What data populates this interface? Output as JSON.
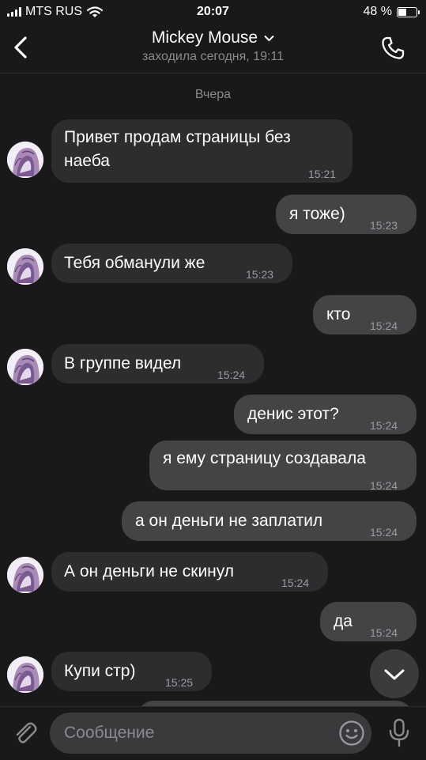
{
  "status_bar": {
    "carrier": "MTS RUS",
    "time": "20:07",
    "battery_percent": "48 %",
    "battery_level": 0.48
  },
  "header": {
    "title": "Mickey Mouse",
    "subtitle": "заходила сегодня, 19:11"
  },
  "chat": {
    "date_separator": "Вчера",
    "messages": [
      {
        "from": "in",
        "text": "Привет продам страницы без наеба",
        "time": "15:21"
      },
      {
        "from": "out",
        "text": "я тоже)",
        "time": "15:23"
      },
      {
        "from": "in",
        "text": "Тебя обманули же",
        "time": "15:23"
      },
      {
        "from": "out",
        "text": "кто",
        "time": "15:24"
      },
      {
        "from": "in",
        "text": "В группе видел",
        "time": "15:24"
      },
      {
        "from": "out",
        "text": "денис этот?",
        "time": "15:24"
      },
      {
        "from": "out",
        "text": "я ему страницу создавала",
        "time": "15:24"
      },
      {
        "from": "out",
        "text": "а он деньги не заплатил",
        "time": "15:24"
      },
      {
        "from": "in",
        "text": "А он деньги не скинул",
        "time": "15:24"
      },
      {
        "from": "out",
        "text": "да",
        "time": "15:24"
      },
      {
        "from": "in",
        "text": "Купи стр)",
        "time": "15:25"
      }
    ]
  },
  "input": {
    "placeholder": "Сообщение"
  },
  "icons": {
    "back": "chevron-left-icon",
    "call": "phone-icon",
    "attach": "paperclip-icon",
    "emoji": "smile-icon",
    "voice": "microphone-icon",
    "scroll": "chevron-down-icon"
  },
  "colors": {
    "background": "#19191a",
    "incoming_bubble": "#2d2d2f",
    "outgoing_bubble": "#444446",
    "secondary_text": "#8a8a8e"
  }
}
